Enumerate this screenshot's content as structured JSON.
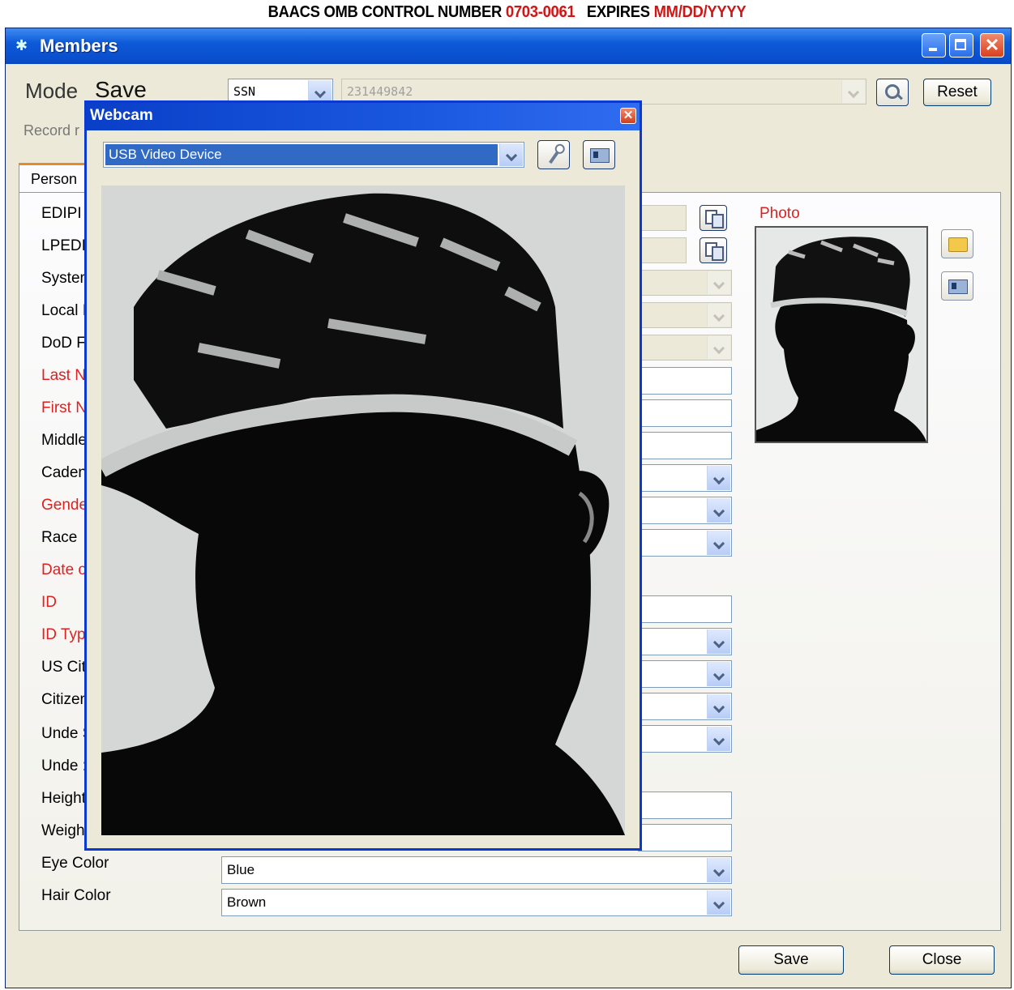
{
  "omb": {
    "prefix": "BAACS OMB CONTROL NUMBER",
    "number": "0703-0061",
    "expires_label": "EXPIRES",
    "expires_value": "MM/DD/YYYY"
  },
  "window": {
    "title": "Members"
  },
  "header": {
    "mode_label": "Mode",
    "mode_value": "Save",
    "record_label": "Record r",
    "id_type": "SSN",
    "id_value": "231449842",
    "reset_label": "Reset"
  },
  "tabs": [
    {
      "label": "Person"
    }
  ],
  "fields": [
    {
      "label": "EDIPI"
    },
    {
      "label": "LPEDI"
    },
    {
      "label": "System"
    },
    {
      "label": "Local I"
    },
    {
      "label": "DoD F"
    },
    {
      "label": "Last N"
    },
    {
      "label": "First N"
    },
    {
      "label": "Middle"
    },
    {
      "label": "Cadence"
    },
    {
      "label": "Gende"
    },
    {
      "label": "Race"
    },
    {
      "label": "Date o"
    },
    {
      "label": "ID"
    },
    {
      "label": "ID Typ"
    },
    {
      "label": "US Cit"
    },
    {
      "label": "Citizen"
    },
    {
      "label": "Unde S"
    },
    {
      "label": "Unde :"
    },
    {
      "label": "Height"
    },
    {
      "label": "Weigh"
    },
    {
      "label": "Eye Color",
      "value": "Blue"
    },
    {
      "label": "Hair Color",
      "value": "Brown"
    }
  ],
  "photo": {
    "label": "Photo"
  },
  "webcam": {
    "title": "Webcam",
    "device": "USB Video Device"
  },
  "footer": {
    "save_label": "Save",
    "close_label": "Close"
  },
  "colors": {
    "required": "#e02020",
    "titlebar": "#0a4fcd",
    "selection": "#316ac5"
  }
}
